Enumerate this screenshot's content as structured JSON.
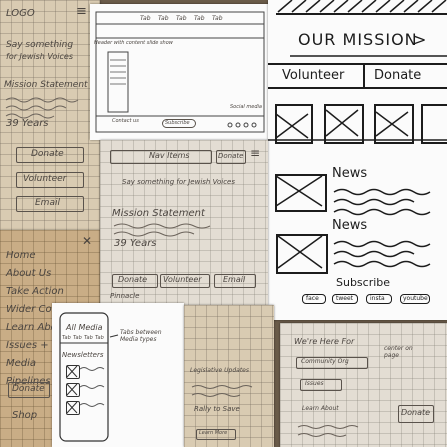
{
  "left_sheet": {
    "logo": "LOGO",
    "tagline_line1": "Say something",
    "tagline_line2": "for Jewish Voices",
    "mission": "Mission Statement",
    "years": "39 Years",
    "donate": "Donate",
    "volunteer": "Volunteer",
    "email": "Email"
  },
  "nav_sheet": {
    "items": [
      "Home",
      "About Us",
      "Take Action",
      "Wider Comm.",
      "Learn About",
      "Issues +",
      "Media",
      "Pipelines"
    ],
    "donate": "Donate",
    "shop": "Shop"
  },
  "desktop_wireframe": {
    "tabs": [
      "Tab",
      "Tab",
      "Tab",
      "Tab",
      "Tab"
    ],
    "note_left": "Header with content slide show",
    "contact": "Contact us",
    "subscribe": "Subscribe",
    "social_note": "Social media"
  },
  "mission_sheet": {
    "title": "OUR MISSION",
    "chevron": ">",
    "volunteer": "Volunteer",
    "donate": "Donate",
    "news1": "News",
    "news2": "News",
    "subscribe": "Subscribe",
    "social": [
      "face",
      "tweet",
      "insta",
      "youtube"
    ]
  },
  "center_sheet": {
    "nav": "Nav Items",
    "donate": "Donate",
    "tagline": "Say something for Jewish Voices",
    "mission": "Mission Statement",
    "years": "39 Years",
    "donate_btn": "Donate",
    "volunteer_btn": "Volunteer",
    "email_btn": "Email",
    "footer": "Pinnacle"
  },
  "media_sheet": {
    "title": "All Media",
    "tabs": [
      "Tab",
      "Tab",
      "Tab",
      "Tab"
    ],
    "newsletters": "Newsletters",
    "note": "Tabs between Media types"
  },
  "bottom_center_sheet": {
    "label": "Legislative Updates",
    "button": "Rally to Save",
    "small": "Learn More"
  },
  "bottom_right_sheet": {
    "title": "We're Here For",
    "row1": "Community Org",
    "row2": "Issues",
    "row3": "Learn About",
    "note": "center on page",
    "donate": "Donate"
  },
  "colors": {
    "pencil": "#4b4540",
    "ink": "#1c1c1c",
    "paper_tan": "#d9cbb2",
    "paper_white": "#fbfbfb"
  }
}
